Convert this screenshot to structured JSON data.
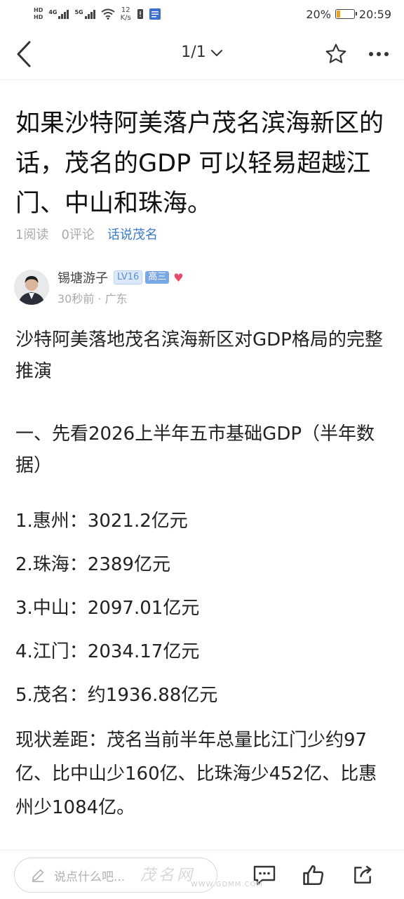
{
  "status_bar": {
    "hd_top": "HD",
    "hd_bottom": "HD",
    "net1": "4G",
    "net2": "5G",
    "speed_value": "12",
    "speed_unit": "K/s",
    "battery_text": "20%",
    "battery_level": 0.2,
    "time": "20:59"
  },
  "nav": {
    "page_indicator": "1/1"
  },
  "article": {
    "title": "如果沙特阿美落户茂名滨海新区的话，茂名的GDP 可以轻易超越江门、中山和珠海。",
    "reads": "1阅读",
    "comments": "0评论",
    "forum": "话说茂名",
    "author": {
      "name": "锡塘游子",
      "level": "LV16",
      "grade": "高三",
      "time": "30秒前",
      "location": "广东"
    },
    "paragraphs": {
      "p1": "沙特阿美落地茂名滨海新区对GDP格局的完整推演",
      "p2": "一、先看2026上半年五市基础GDP（半年数据）",
      "l1": "1.惠州：3021.2亿元",
      "l2": "2.珠海：2389亿元",
      "l3": "3.中山：2097.01亿元",
      "l4": "4.江门：2034.17亿元",
      "l5": "5.茂名：约1936.88亿元",
      "p3": "现状差距：茂名当前半年总量比江门少约97亿、比中山少160亿、比珠海少452亿、比惠州少1084亿。"
    }
  },
  "bottom_bar": {
    "comment_placeholder": "说点什么吧...",
    "watermark": "茂名网",
    "watermark_url": "WWW.GDMM.COM"
  },
  "colors": {
    "accent": "#3b7cc6",
    "battery": "#f0a020",
    "heart": "#e84b6a"
  }
}
